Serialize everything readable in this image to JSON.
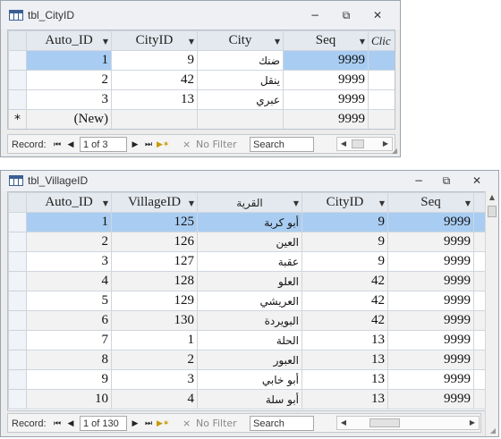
{
  "window1": {
    "title": "tbl_CityID",
    "columns": [
      "Auto_ID",
      "CityID",
      "City",
      "Seq",
      "Clic"
    ],
    "rows": [
      {
        "auto_id": "1",
        "city_id": "9",
        "city": "ضنك",
        "seq": "9999"
      },
      {
        "auto_id": "2",
        "city_id": "42",
        "city": "ينقل",
        "seq": "9999"
      },
      {
        "auto_id": "3",
        "city_id": "13",
        "city": "عبري",
        "seq": "9999"
      }
    ],
    "new_row": {
      "marker": "*",
      "auto_id": "(New)",
      "seq": "9999"
    },
    "nav": {
      "record_label": "Record:",
      "position": "1 of 3",
      "filter_label": "No Filter",
      "search_placeholder": "Search"
    }
  },
  "window2": {
    "title": "tbl_VillageID",
    "columns": [
      "Auto_ID",
      "VillageID",
      "القرية",
      "CityID",
      "Seq"
    ],
    "rows": [
      {
        "auto_id": "1",
        "village_id": "125",
        "village": "أبو كربة",
        "city_id": "9",
        "seq": "9999"
      },
      {
        "auto_id": "2",
        "village_id": "126",
        "village": "العين",
        "city_id": "9",
        "seq": "9999"
      },
      {
        "auto_id": "3",
        "village_id": "127",
        "village": "عقبة",
        "city_id": "9",
        "seq": "9999"
      },
      {
        "auto_id": "4",
        "village_id": "128",
        "village": "العلو",
        "city_id": "42",
        "seq": "9999"
      },
      {
        "auto_id": "5",
        "village_id": "129",
        "village": "العريشي",
        "city_id": "42",
        "seq": "9999"
      },
      {
        "auto_id": "6",
        "village_id": "130",
        "village": "البويردة",
        "city_id": "42",
        "seq": "9999"
      },
      {
        "auto_id": "7",
        "village_id": "1",
        "village": "الحلة",
        "city_id": "13",
        "seq": "9999"
      },
      {
        "auto_id": "8",
        "village_id": "2",
        "village": "العبور",
        "city_id": "13",
        "seq": "9999"
      },
      {
        "auto_id": "9",
        "village_id": "3",
        "village": "أبو خابي",
        "city_id": "13",
        "seq": "9999"
      },
      {
        "auto_id": "10",
        "village_id": "4",
        "village": "أبو سلة",
        "city_id": "13",
        "seq": "9999"
      }
    ],
    "nav": {
      "record_label": "Record:",
      "position": "1 of 130",
      "filter_label": "No Filter",
      "search_placeholder": "Search"
    }
  },
  "icons": {
    "minimize": "minimize-icon",
    "restore": "restore-icon",
    "close": "close-icon"
  },
  "colors": {
    "selected_row": "#a9cdf2",
    "header_bg": "#e4e9ef"
  }
}
